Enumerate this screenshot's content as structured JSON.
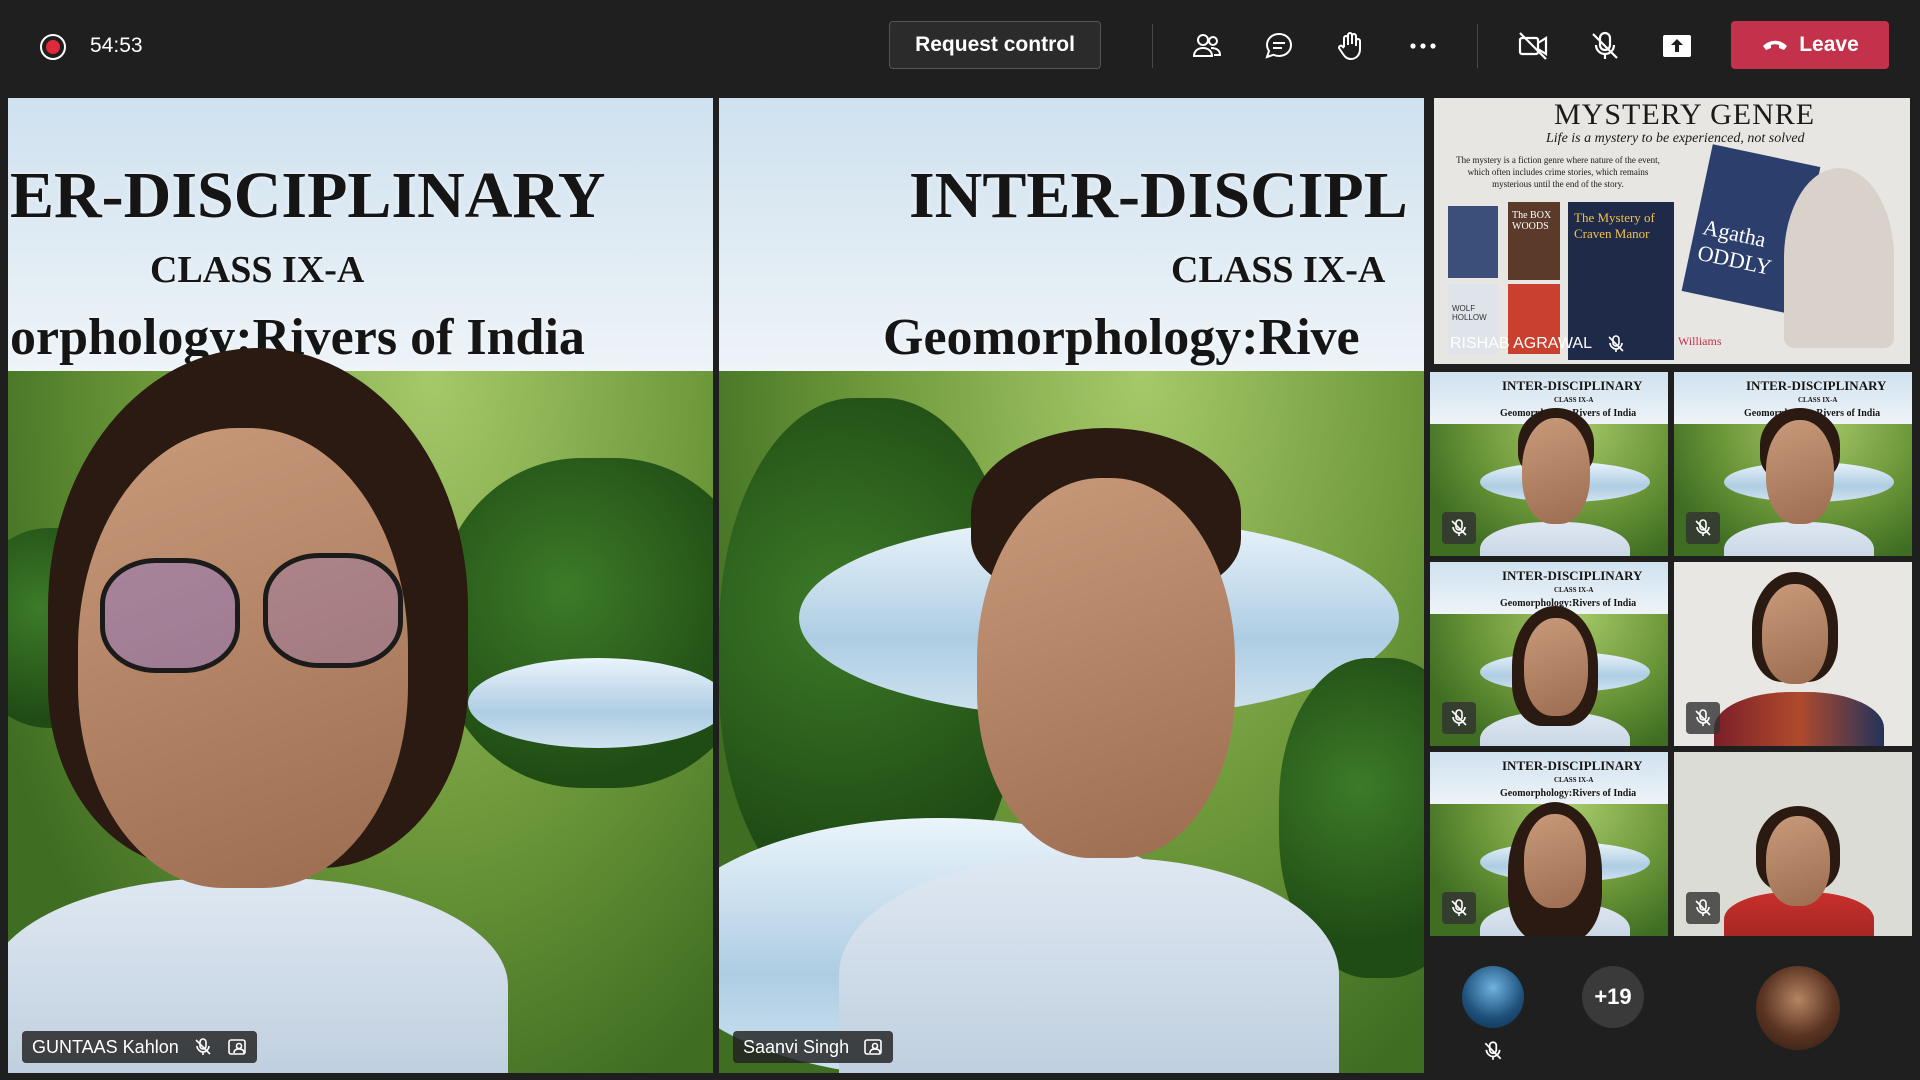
{
  "meeting": {
    "timer": "54:53",
    "request_control_label": "Request control",
    "leave_label": "Leave"
  },
  "colors": {
    "topbar": "#1f1f1f",
    "leave": "#c4314b",
    "active_outline": "#7f85f5",
    "record": "#e0293b"
  },
  "toolbar_icons": [
    "participants-icon",
    "chat-icon",
    "raise-hand-icon",
    "more-options-icon",
    "camera-off-icon",
    "mic-off-icon",
    "share-screen-icon"
  ],
  "slide": {
    "title_left": "ER-DISCIPLINARY",
    "title_center": "INTER-DISCIPL",
    "title_small": "INTER-DISCIPLINARY",
    "class_label": "CLASS IX-A",
    "subtitle_left": "orphology:Rivers of India",
    "subtitle_center": "Geomorphology:Rive",
    "subtitle_small": "Geomorphology:Rivers of India",
    "class_label_small": "CLASS IX-A"
  },
  "participants": {
    "left_main": {
      "name": "GUNTAAS Kahlon"
    },
    "center_main": {
      "name": "Saanvi Singh"
    },
    "shared": {
      "name": "RISHAB AGRAWAL",
      "heading": "MYSTERY GENRE",
      "tagline": "Life is a mystery to be experienced, not solved",
      "body": "The mystery is a fiction genre where nature of the event, which often includes crime stories, which remains mysterious until the end of the story.",
      "book1": "The BOX WOODS",
      "book2": "The Mystery of Craven Manor",
      "book3": "Agatha ODDLY",
      "book4": "WOLF HOLLOW",
      "book5": "Williams"
    },
    "overflow_count": "+19"
  }
}
